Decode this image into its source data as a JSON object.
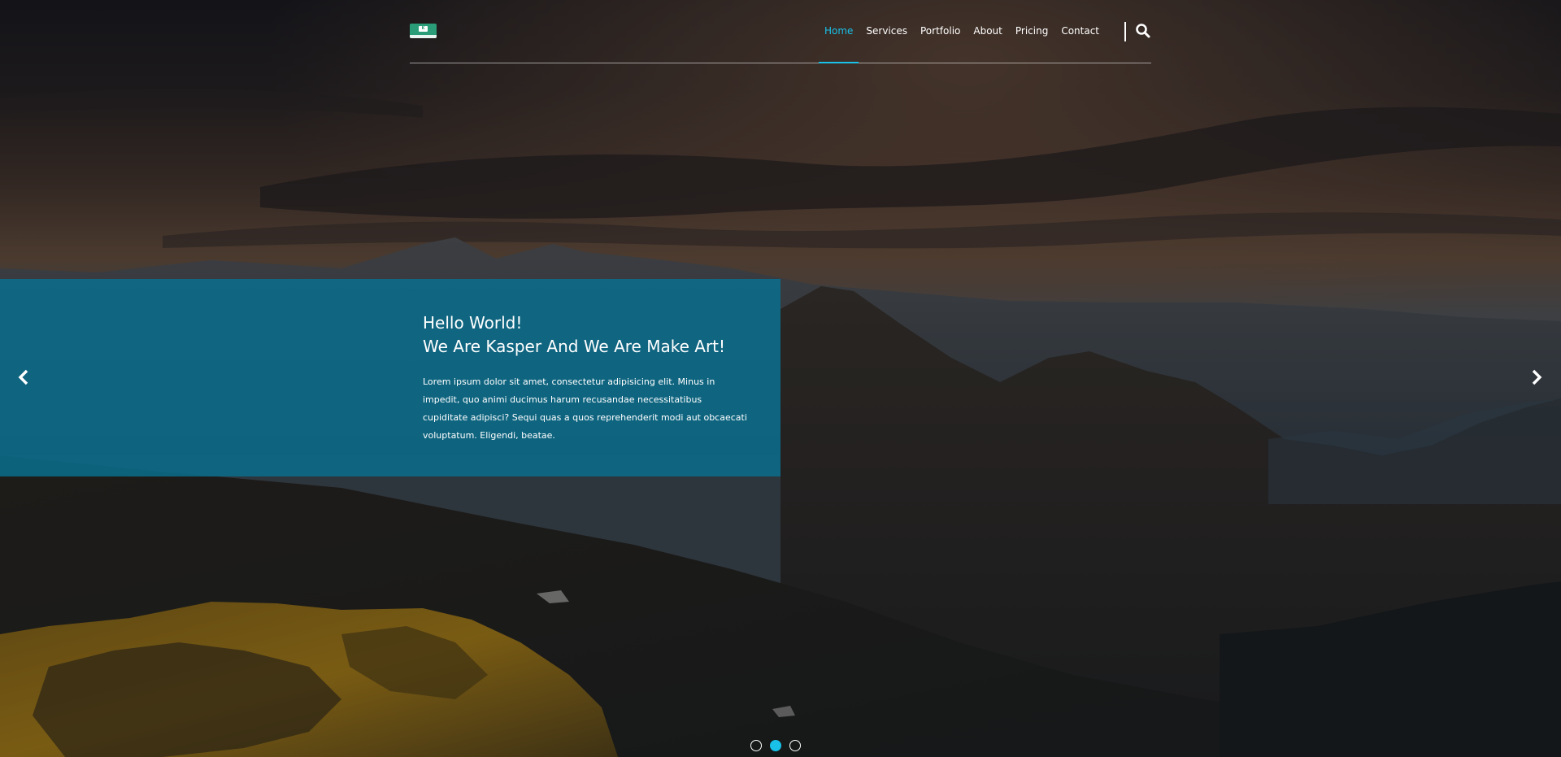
{
  "header": {
    "nav_items": [
      {
        "label": "Home"
      },
      {
        "label": "Services"
      },
      {
        "label": "Portfolio"
      },
      {
        "label": "About"
      },
      {
        "label": "Pricing"
      },
      {
        "label": "Contact"
      }
    ],
    "active_nav": "Home",
    "search_icon": "search-icon",
    "logo_icon": "logo-icon"
  },
  "slider": {
    "title_line1": "Hello World!",
    "title_line2": "We Are Kasper And We Are Make Art!",
    "text": "Lorem ipsum dolor sit amet, consectetur adipisicing elit. Minus in impedit, quo animi ducimus harum recusandae necessitatibus cupiditate adipisci? Sequi quas a quos reprehenderit modi aut obcaecati voluptatum. Eligendi, beatae.",
    "prev_icon": "chevron-left-icon",
    "next_icon": "chevron-right-icon",
    "slide_count": 3,
    "active_slide": 2
  },
  "colors": {
    "accent": "#19c0e8",
    "caption_bg": "#0b6e8c",
    "logo": "#2a9d78"
  }
}
